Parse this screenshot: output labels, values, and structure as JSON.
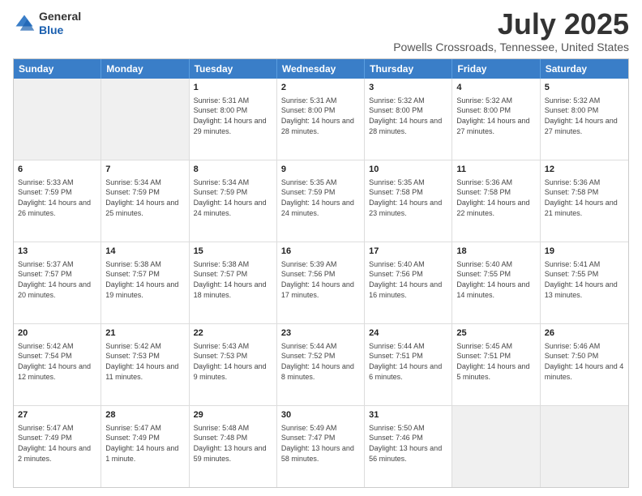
{
  "logo": {
    "general": "General",
    "blue": "Blue"
  },
  "title": "July 2025",
  "subtitle": "Powells Crossroads, Tennessee, United States",
  "headers": [
    "Sunday",
    "Monday",
    "Tuesday",
    "Wednesday",
    "Thursday",
    "Friday",
    "Saturday"
  ],
  "weeks": [
    [
      {
        "day": "",
        "text": ""
      },
      {
        "day": "",
        "text": ""
      },
      {
        "day": "1",
        "text": "Sunrise: 5:31 AM\nSunset: 8:00 PM\nDaylight: 14 hours and 29 minutes."
      },
      {
        "day": "2",
        "text": "Sunrise: 5:31 AM\nSunset: 8:00 PM\nDaylight: 14 hours and 28 minutes."
      },
      {
        "day": "3",
        "text": "Sunrise: 5:32 AM\nSunset: 8:00 PM\nDaylight: 14 hours and 28 minutes."
      },
      {
        "day": "4",
        "text": "Sunrise: 5:32 AM\nSunset: 8:00 PM\nDaylight: 14 hours and 27 minutes."
      },
      {
        "day": "5",
        "text": "Sunrise: 5:32 AM\nSunset: 8:00 PM\nDaylight: 14 hours and 27 minutes."
      }
    ],
    [
      {
        "day": "6",
        "text": "Sunrise: 5:33 AM\nSunset: 7:59 PM\nDaylight: 14 hours and 26 minutes."
      },
      {
        "day": "7",
        "text": "Sunrise: 5:34 AM\nSunset: 7:59 PM\nDaylight: 14 hours and 25 minutes."
      },
      {
        "day": "8",
        "text": "Sunrise: 5:34 AM\nSunset: 7:59 PM\nDaylight: 14 hours and 24 minutes."
      },
      {
        "day": "9",
        "text": "Sunrise: 5:35 AM\nSunset: 7:59 PM\nDaylight: 14 hours and 24 minutes."
      },
      {
        "day": "10",
        "text": "Sunrise: 5:35 AM\nSunset: 7:58 PM\nDaylight: 14 hours and 23 minutes."
      },
      {
        "day": "11",
        "text": "Sunrise: 5:36 AM\nSunset: 7:58 PM\nDaylight: 14 hours and 22 minutes."
      },
      {
        "day": "12",
        "text": "Sunrise: 5:36 AM\nSunset: 7:58 PM\nDaylight: 14 hours and 21 minutes."
      }
    ],
    [
      {
        "day": "13",
        "text": "Sunrise: 5:37 AM\nSunset: 7:57 PM\nDaylight: 14 hours and 20 minutes."
      },
      {
        "day": "14",
        "text": "Sunrise: 5:38 AM\nSunset: 7:57 PM\nDaylight: 14 hours and 19 minutes."
      },
      {
        "day": "15",
        "text": "Sunrise: 5:38 AM\nSunset: 7:57 PM\nDaylight: 14 hours and 18 minutes."
      },
      {
        "day": "16",
        "text": "Sunrise: 5:39 AM\nSunset: 7:56 PM\nDaylight: 14 hours and 17 minutes."
      },
      {
        "day": "17",
        "text": "Sunrise: 5:40 AM\nSunset: 7:56 PM\nDaylight: 14 hours and 16 minutes."
      },
      {
        "day": "18",
        "text": "Sunrise: 5:40 AM\nSunset: 7:55 PM\nDaylight: 14 hours and 14 minutes."
      },
      {
        "day": "19",
        "text": "Sunrise: 5:41 AM\nSunset: 7:55 PM\nDaylight: 14 hours and 13 minutes."
      }
    ],
    [
      {
        "day": "20",
        "text": "Sunrise: 5:42 AM\nSunset: 7:54 PM\nDaylight: 14 hours and 12 minutes."
      },
      {
        "day": "21",
        "text": "Sunrise: 5:42 AM\nSunset: 7:53 PM\nDaylight: 14 hours and 11 minutes."
      },
      {
        "day": "22",
        "text": "Sunrise: 5:43 AM\nSunset: 7:53 PM\nDaylight: 14 hours and 9 minutes."
      },
      {
        "day": "23",
        "text": "Sunrise: 5:44 AM\nSunset: 7:52 PM\nDaylight: 14 hours and 8 minutes."
      },
      {
        "day": "24",
        "text": "Sunrise: 5:44 AM\nSunset: 7:51 PM\nDaylight: 14 hours and 6 minutes."
      },
      {
        "day": "25",
        "text": "Sunrise: 5:45 AM\nSunset: 7:51 PM\nDaylight: 14 hours and 5 minutes."
      },
      {
        "day": "26",
        "text": "Sunrise: 5:46 AM\nSunset: 7:50 PM\nDaylight: 14 hours and 4 minutes."
      }
    ],
    [
      {
        "day": "27",
        "text": "Sunrise: 5:47 AM\nSunset: 7:49 PM\nDaylight: 14 hours and 2 minutes."
      },
      {
        "day": "28",
        "text": "Sunrise: 5:47 AM\nSunset: 7:49 PM\nDaylight: 14 hours and 1 minute."
      },
      {
        "day": "29",
        "text": "Sunrise: 5:48 AM\nSunset: 7:48 PM\nDaylight: 13 hours and 59 minutes."
      },
      {
        "day": "30",
        "text": "Sunrise: 5:49 AM\nSunset: 7:47 PM\nDaylight: 13 hours and 58 minutes."
      },
      {
        "day": "31",
        "text": "Sunrise: 5:50 AM\nSunset: 7:46 PM\nDaylight: 13 hours and 56 minutes."
      },
      {
        "day": "",
        "text": ""
      },
      {
        "day": "",
        "text": ""
      }
    ]
  ]
}
